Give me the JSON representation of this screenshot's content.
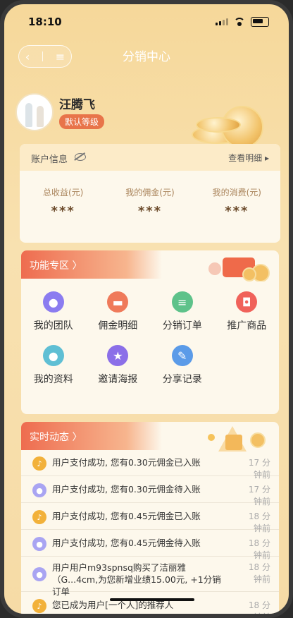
{
  "status_bar": {
    "time": "18:10"
  },
  "nav": {
    "title": "分销中心",
    "back": "‹",
    "menu": "≡"
  },
  "profile": {
    "name": "汪腾飞",
    "level": "默认等级"
  },
  "account": {
    "title": "账户信息",
    "detail_link": "查看明细 ▸",
    "stats": [
      {
        "label": "总收益(元)",
        "value": "***"
      },
      {
        "label": "我的佣金(元)",
        "value": "***"
      },
      {
        "label": "我的消费(元)",
        "value": "***"
      }
    ]
  },
  "functions": {
    "title": "功能专区 〉",
    "items": [
      {
        "label": "我的团队",
        "icon": "team-icon",
        "color": "#8b7cf0"
      },
      {
        "label": "佣金明细",
        "icon": "wallet-icon",
        "color": "#ef7a5a"
      },
      {
        "label": "分销订单",
        "icon": "clipboard-icon",
        "color": "#5ec28a"
      },
      {
        "label": "推广商品",
        "icon": "shopping-bag-icon",
        "color": "#f0625a"
      },
      {
        "label": "我的资料",
        "icon": "profile-icon",
        "color": "#5fbfd4"
      },
      {
        "label": "邀请海报",
        "icon": "star-badge-icon",
        "color": "#8b6fe8"
      },
      {
        "label": "分享记录",
        "icon": "edit-doc-icon",
        "color": "#5b9be8"
      }
    ]
  },
  "feed": {
    "title": "实时动态 〉",
    "items": [
      {
        "text": "用户支付成功, 您有0.30元佣金已入账",
        "time": "17 分钟前",
        "kind": "bell",
        "color": "#f2b13a"
      },
      {
        "text": "用户支付成功, 您有0.30元佣金待入账",
        "time": "17 分钟前",
        "kind": "user",
        "color": "#a9a4f2"
      },
      {
        "text": "用户支付成功, 您有0.45元佣金已入账",
        "time": "18 分钟前",
        "kind": "bell",
        "color": "#f2b13a"
      },
      {
        "text": "用户支付成功, 您有0.45元佣金待入账",
        "time": "18 分钟前",
        "kind": "user",
        "color": "#a9a4f2"
      },
      {
        "text": "用户用户m93spnsq购买了洁丽雅（G...4cm,为您新增业绩15.00元, +1分销订单",
        "time": "18 分钟前",
        "kind": "user",
        "color": "#a9a4f2"
      },
      {
        "text": "您已成为用户[一个人]的推荐人",
        "time": "18 分钟前",
        "kind": "bell",
        "color": "#f2b13a"
      }
    ]
  }
}
